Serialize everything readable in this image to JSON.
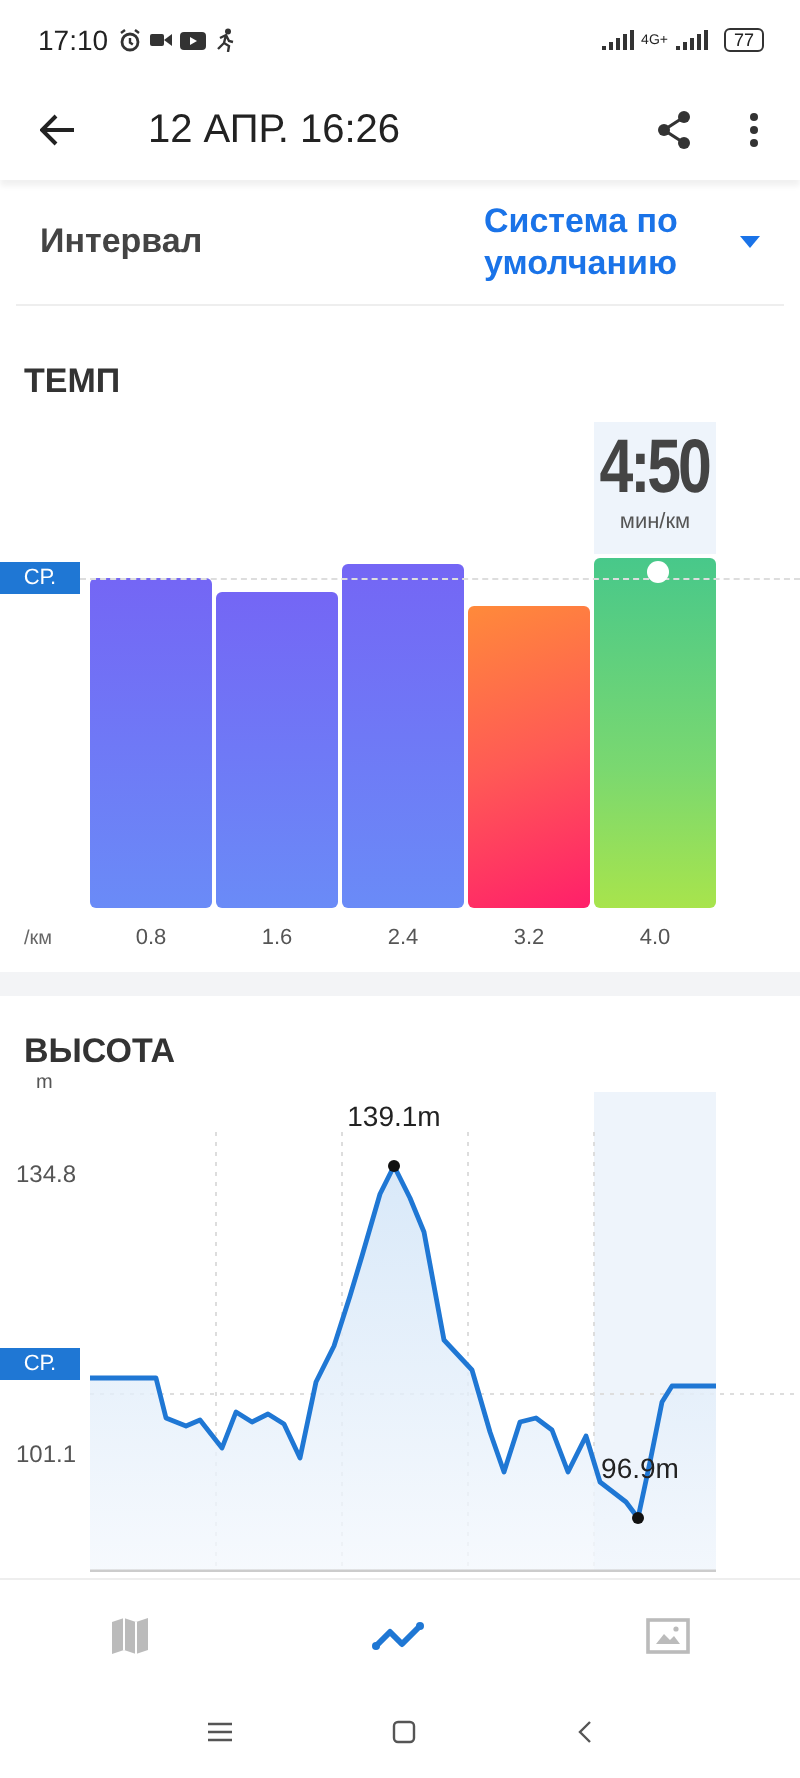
{
  "status_bar": {
    "time": "17:10",
    "network": "4G+",
    "battery": "77"
  },
  "header": {
    "title": "12 АПР. 16:26"
  },
  "interval": {
    "label": "Интервал",
    "value": "Система по умолчанию"
  },
  "pace": {
    "title": "ТЕМП",
    "highlight_value": "4:50",
    "highlight_unit": "мин/км",
    "avg_label": "СР.",
    "unit_label": "/км",
    "bars": [
      {
        "label": "0.8",
        "kind": "normal",
        "selected": false
      },
      {
        "label": "1.6",
        "kind": "normal",
        "selected": false
      },
      {
        "label": "2.4",
        "kind": "normal",
        "selected": false
      },
      {
        "label": "3.2",
        "kind": "slow",
        "selected": false
      },
      {
        "label": "4.0",
        "kind": "fast",
        "selected": true
      }
    ]
  },
  "elevation": {
    "title": "ВЫСОТА",
    "unit": "m",
    "avg_label": "СР.",
    "y_labels": [
      "134.8",
      "101.1"
    ],
    "max_label": "139.1m",
    "min_label": "96.9m"
  },
  "bottom_nav": [
    {
      "kind": "map",
      "selected": false
    },
    {
      "kind": "chart",
      "selected": true
    },
    {
      "kind": "image",
      "selected": false
    }
  ]
}
